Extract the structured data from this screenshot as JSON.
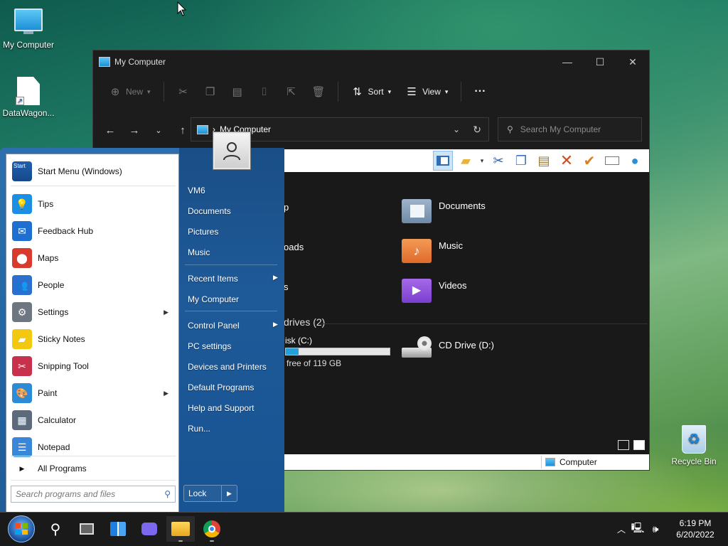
{
  "desktop": {
    "icons": [
      {
        "label": "My Computer"
      },
      {
        "label": "DataWagon..."
      },
      {
        "label": "Recycle Bin"
      }
    ]
  },
  "explorer": {
    "title": "My Computer",
    "toolbar": {
      "new_label": "New",
      "sort_label": "Sort",
      "view_label": "View",
      "more_label": "···"
    },
    "address": {
      "separator": "›",
      "location": "My Computer"
    },
    "search_placeholder": "Search My Computer",
    "folders": [
      {
        "label": "Documents",
        "partial_left": "p"
      },
      {
        "label": "Music",
        "partial_left": "oads"
      },
      {
        "label": "Videos",
        "partial_left": "s"
      }
    ],
    "drives_section": {
      "heading": "drives (2)",
      "local_disk_label": "isk (C:)",
      "local_disk_free": "free of 119 GB",
      "local_disk_used_fraction": 0.12,
      "cd_drive_label": "CD Drive (D:)"
    },
    "status_bar": {
      "location": "Computer"
    }
  },
  "start_menu": {
    "header_label": "Start Menu (Windows)",
    "header_tile_text": "Start",
    "apps": [
      {
        "label": "Tips",
        "icon": "lightbulb-icon",
        "color": "#1a8fe3"
      },
      {
        "label": "Feedback Hub",
        "icon": "feedback-icon",
        "color": "#1f6fd1"
      },
      {
        "label": "Maps",
        "icon": "map-pin-icon",
        "color": "#d83b2b"
      },
      {
        "label": "People",
        "icon": "people-icon",
        "color": "#2b6fcf"
      },
      {
        "label": "Settings",
        "icon": "gear-icon",
        "color": "#6e7681",
        "submenu": true
      },
      {
        "label": "Sticky Notes",
        "icon": "sticky-note-icon",
        "color": "#f2c811"
      },
      {
        "label": "Snipping Tool",
        "icon": "scissors-icon",
        "color": "#c9304b"
      },
      {
        "label": "Paint",
        "icon": "palette-icon",
        "color": "#2c8bd6",
        "submenu": true
      },
      {
        "label": "Calculator",
        "icon": "calculator-icon",
        "color": "#5b6b7b"
      },
      {
        "label": "Notepad",
        "icon": "notepad-icon",
        "color": "#3a86d9"
      }
    ],
    "all_programs_label": "All Programs",
    "search_placeholder": "Search programs and files",
    "right_links": [
      {
        "label": "VM6"
      },
      {
        "label": "Documents"
      },
      {
        "label": "Pictures"
      },
      {
        "label": "Music"
      },
      {
        "label": "Recent Items",
        "submenu": true
      },
      {
        "label": "My Computer"
      },
      {
        "label": "Control Panel",
        "submenu": true
      },
      {
        "label": "PC settings"
      },
      {
        "label": "Devices and Printers"
      },
      {
        "label": "Default Programs"
      },
      {
        "label": "Help and Support"
      },
      {
        "label": "Run..."
      }
    ],
    "lock_label": "Lock"
  },
  "taskbar": {
    "clock_time": "6:19 PM",
    "clock_date": "6/20/2022"
  }
}
